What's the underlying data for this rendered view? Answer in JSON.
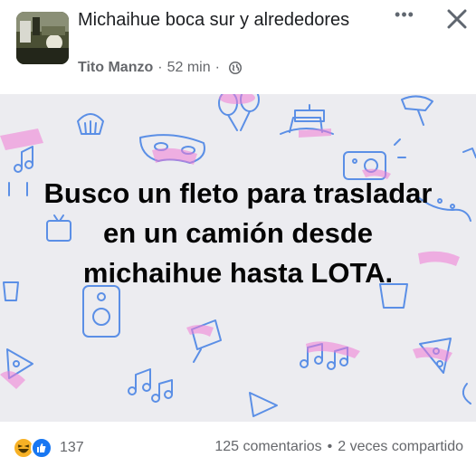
{
  "post": {
    "group_name": "Michaihue boca sur y alrededores",
    "author": "Tito Manzo",
    "separator": "·",
    "time": "52 min",
    "more_label": "•••",
    "body": "Busco un fleto para trasladar en un camión desde michaihue hasta LOTA."
  },
  "stats": {
    "reaction_count": "137",
    "comments": "125 comentarios",
    "dot": "•",
    "shares": "2 veces compartido"
  },
  "colors": {
    "background_gray": "#ececf0",
    "doodle_blue": "#5b8fe6",
    "doodle_pink": "#f07bd6",
    "like_blue": "#1877f2",
    "haha_yellow": "#f7b125"
  },
  "icons": {
    "privacy": "globe-icon",
    "close": "close-icon",
    "more": "more-options-icon",
    "reactions": [
      "haha-reaction-icon",
      "like-reaction-icon"
    ]
  }
}
